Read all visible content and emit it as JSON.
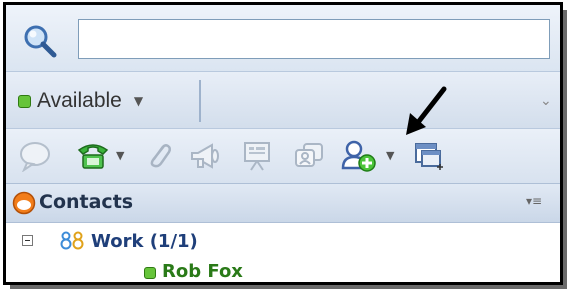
{
  "search": {
    "placeholder": "",
    "value": "",
    "icon": "search-icon"
  },
  "status": {
    "label": "Available",
    "color": "#66c43a",
    "overflow_icon": "chevron-double-down-icon"
  },
  "toolbar": {
    "items": [
      {
        "icon": "chat-bubble-icon",
        "enabled": false
      },
      {
        "icon": "phone-icon",
        "enabled": true,
        "has_dropdown": true
      },
      {
        "icon": "paperclip-icon",
        "enabled": false
      },
      {
        "icon": "megaphone-icon",
        "enabled": false
      },
      {
        "icon": "presentation-icon",
        "enabled": false
      },
      {
        "icon": "group-chat-icon",
        "enabled": false
      },
      {
        "icon": "add-contact-icon",
        "enabled": true,
        "has_dropdown": true
      },
      {
        "icon": "add-window-icon",
        "enabled": true
      }
    ],
    "annotation": "arrow-pointer-icon"
  },
  "contacts": {
    "title": "Contacts",
    "menu_icon": "list-menu-icon",
    "groups": [
      {
        "label": "Work (1/1)",
        "expanded": true,
        "members": [
          {
            "name": "Rob Fox",
            "status": "available"
          }
        ]
      }
    ]
  },
  "colors": {
    "accent_blue": "#1f3f7a",
    "online_green": "#2a7a18",
    "panel_bg": "#dde7f3"
  }
}
